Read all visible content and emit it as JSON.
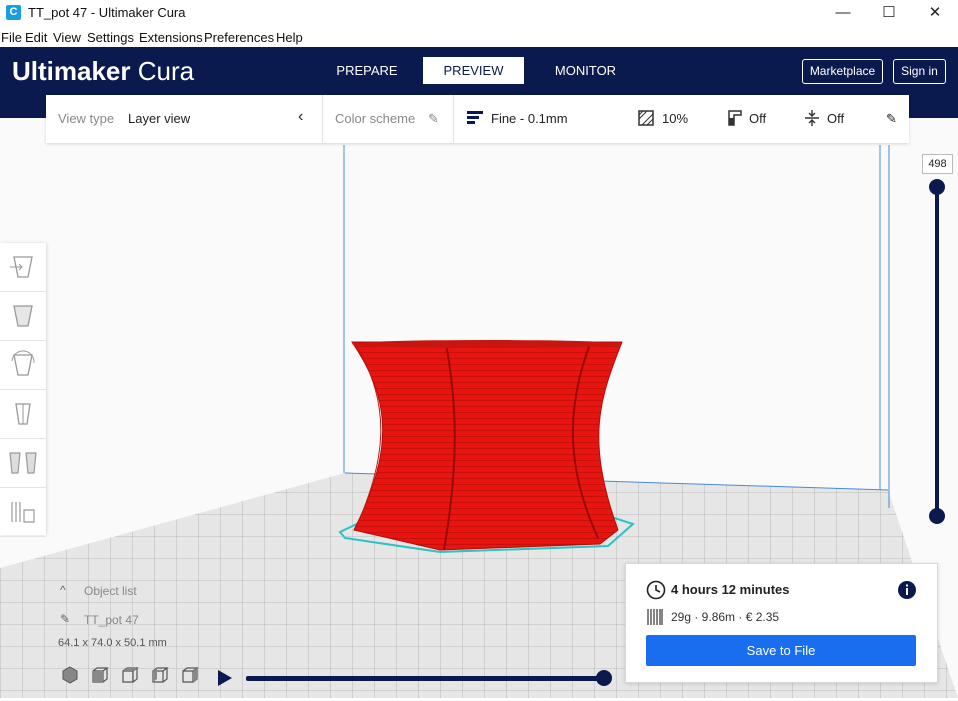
{
  "window": {
    "title": "TT_pot 47 - Ultimaker Cura",
    "app_icon_letter": "C",
    "minimize_glyph": "—",
    "maximize_glyph": "☐",
    "close_glyph": "✕"
  },
  "menu": [
    "File",
    "Edit",
    "View",
    "Settings",
    "Extensions",
    "Preferences",
    "Help"
  ],
  "header": {
    "logo_brand": "Ultimaker",
    "logo_product": "Cura",
    "stages": [
      "PREPARE",
      "PREVIEW",
      "MONITOR"
    ],
    "active_stage": "PREVIEW",
    "marketplace_label": "Marketplace",
    "signin_label": "Sign in"
  },
  "toolbar": {
    "view_type_label": "View type",
    "view_type_value": "Layer view",
    "color_scheme_label": "Color scheme",
    "profile": "Fine - 0.1mm",
    "infill": "10%",
    "support": "Off",
    "adhesion": "Off"
  },
  "layer_slider": {
    "value": "498"
  },
  "object": {
    "list_label": "Object list",
    "name": "TT_pot 47",
    "dimensions": "64.1 x 74.0 x 50.1 mm"
  },
  "job": {
    "print_time": "4 hours 12 minutes",
    "material_summary": "29g · 9.86m · € 2.35",
    "save_label": "Save to File"
  },
  "colors": {
    "header_bg": "#0b1a4e",
    "accent_blue": "#196ef0",
    "model_red": "#e8140f",
    "outline_cyan": "#2ac3c3"
  }
}
